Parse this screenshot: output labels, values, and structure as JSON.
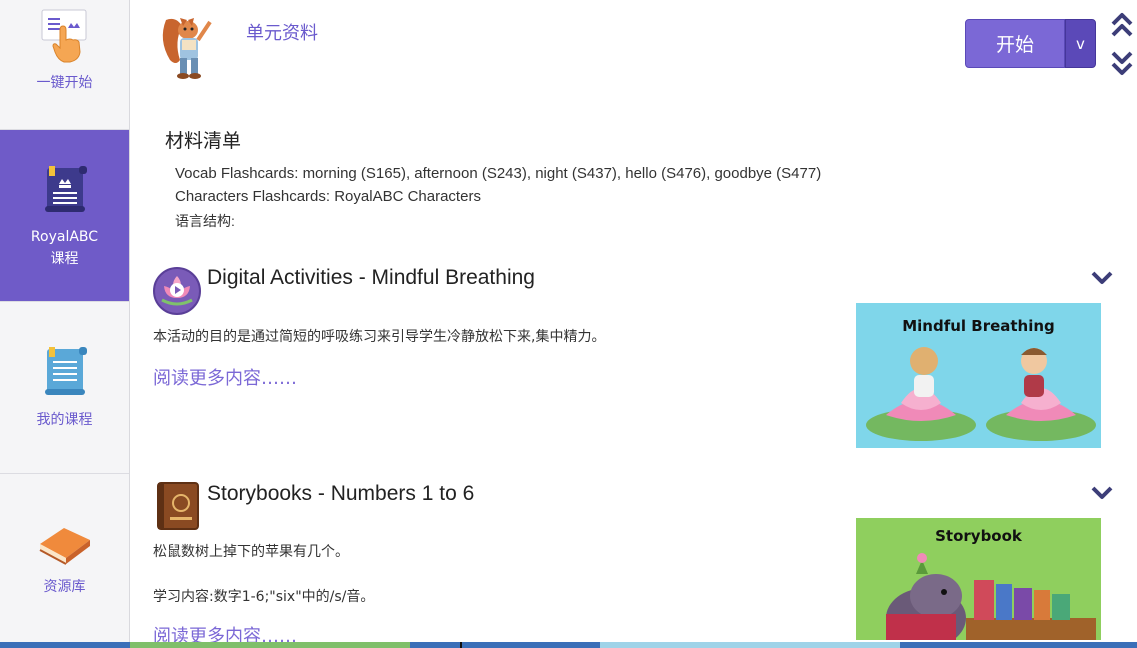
{
  "sidebar": {
    "items": [
      {
        "label_line1": "一键开始",
        "label_line2": ""
      },
      {
        "label_line1": "RoyalABC",
        "label_line2": "课程"
      },
      {
        "label_line1": "我的课程",
        "label_line2": ""
      },
      {
        "label_line1": "资源库",
        "label_line2": ""
      }
    ],
    "active_color": "#6f5bc8",
    "label_color": "#6a5acd"
  },
  "header": {
    "unit_title": "单元资料",
    "start_label": "开始",
    "dropdown_label": "v"
  },
  "materials": {
    "title": "材料清单",
    "lines": [
      "Vocab Flashcards: morning (S165), afternoon (S243), night (S437), hello (S476), goodbye (S477)",
      "Characters Flashcards: RoyalABC Characters",
      "语言结构:"
    ]
  },
  "activities": [
    {
      "title": "Digital Activities - Mindful Breathing",
      "desc": [
        "本活动的目的是通过简短的呼吸练习来引导学生冷静放松下来,集中精力。"
      ],
      "read_more": "阅读更多内容……",
      "thumb_title": "Mindful Breathing",
      "icon": "lotus-play-icon"
    },
    {
      "title": "Storybooks - Numbers 1 to 6",
      "desc": [
        "松鼠数树上掉下的苹果有几个。",
        "学习内容:数字1-6;\"six\"中的/s/音。"
      ],
      "read_more": "阅读更多内容……",
      "thumb_title": "Storybook",
      "icon": "storybook-icon"
    }
  ],
  "colors": {
    "accent": "#7b68d6",
    "accent_dark": "#5b49b8"
  }
}
